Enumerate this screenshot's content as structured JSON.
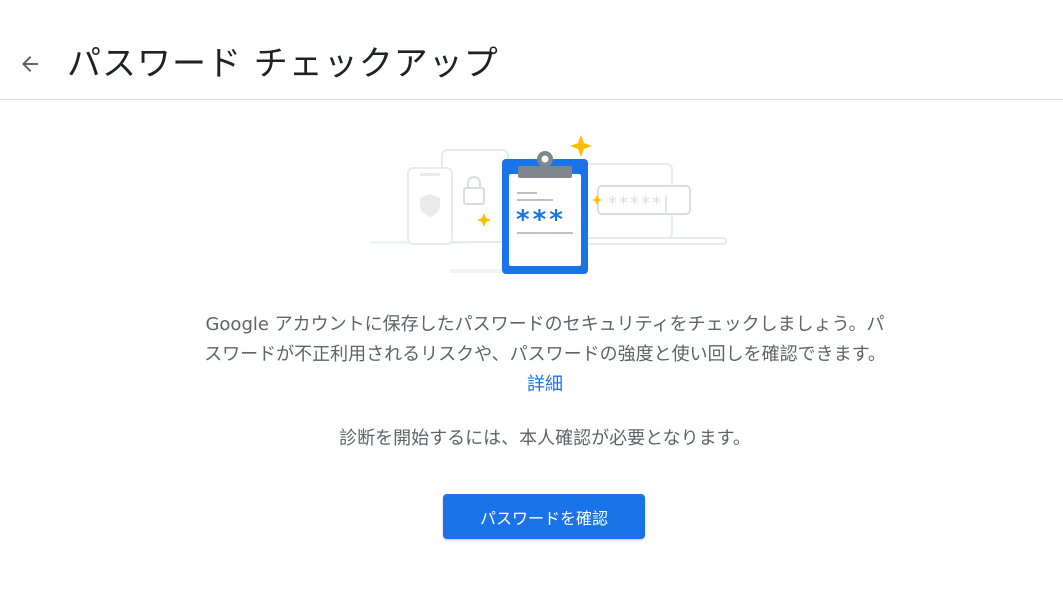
{
  "header": {
    "back_icon": "arrow-back-icon",
    "title": "パスワード チェックアップ"
  },
  "illustration": {
    "icon": "password-checkup-clipboard-illustration",
    "masked_field": "*****|",
    "clipboard_stars": "***"
  },
  "main": {
    "description": "Google アカウントに保存したパスワードのセキュリティをチェックしましょう。パスワードが不正利用されるリスクや、パスワードの強度と使い回しを確認できます。",
    "learn_more_link": "詳細",
    "verify_note": "診断を開始するには、本人確認が必要となります。",
    "check_button_label": "パスワードを確認"
  },
  "colors": {
    "accent": "#1a73e8",
    "title_text": "#202124",
    "body_text": "#5f6368",
    "divider": "#dadce0",
    "sparkle": "#fbbc04"
  }
}
